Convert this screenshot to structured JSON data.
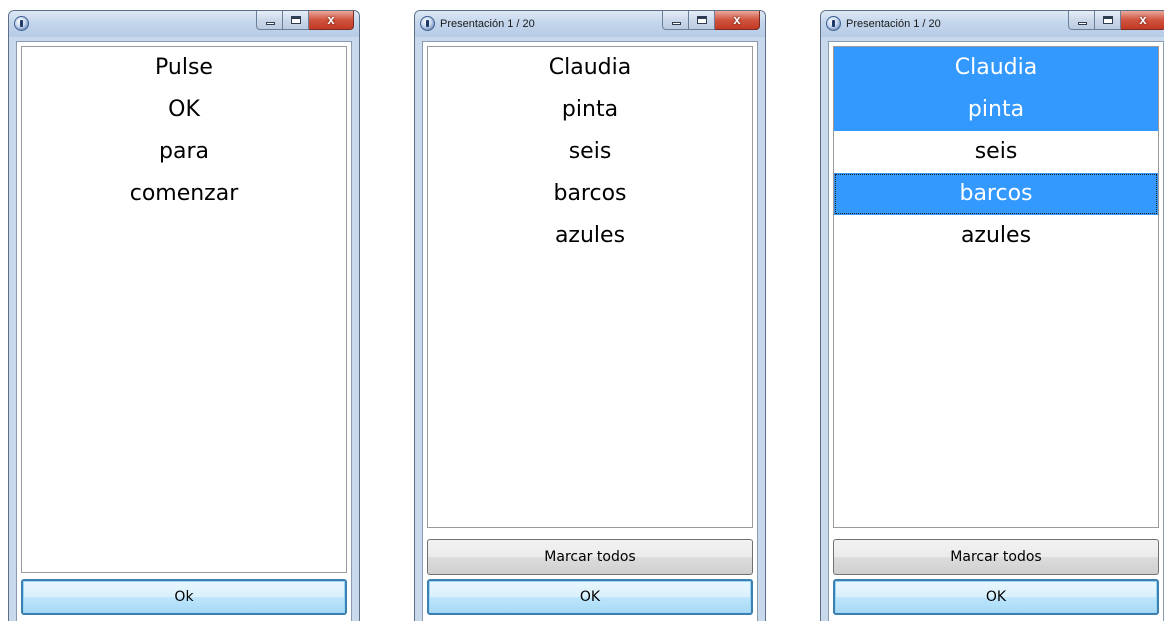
{
  "windows": [
    {
      "title": "",
      "items": [
        {
          "text": "Pulse",
          "selected": false
        },
        {
          "text": "OK",
          "selected": false
        },
        {
          "text": "para",
          "selected": false
        },
        {
          "text": "comenzar",
          "selected": false
        }
      ],
      "ok_label": "Ok"
    },
    {
      "title": "Presentación 1 / 20",
      "items": [
        {
          "text": "Claudia",
          "selected": false
        },
        {
          "text": "pinta",
          "selected": false
        },
        {
          "text": "seis",
          "selected": false
        },
        {
          "text": "barcos",
          "selected": false
        },
        {
          "text": "azules",
          "selected": false
        }
      ],
      "mark_all_label": "Marcar todos",
      "ok_label": "OK"
    },
    {
      "title": "Presentación 1 / 20",
      "items": [
        {
          "text": "Claudia",
          "selected": true
        },
        {
          "text": "pinta",
          "selected": true
        },
        {
          "text": "seis",
          "selected": false
        },
        {
          "text": "barcos",
          "selected": true,
          "focused": true
        },
        {
          "text": "azules",
          "selected": false
        }
      ],
      "mark_all_label": "Marcar todos",
      "ok_label": "OK"
    }
  ],
  "caption_buttons": {
    "close_glyph": "x"
  },
  "colors": {
    "selection": "#3399ff",
    "selection_text": "#ffffff",
    "title_bar": "#c4d6ec",
    "close_button": "#c23a23"
  }
}
